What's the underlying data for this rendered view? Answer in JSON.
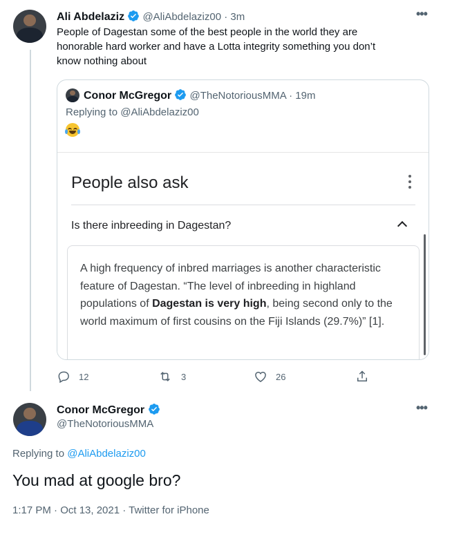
{
  "tweet1": {
    "author_name": "Ali Abdelaziz",
    "author_handle": "@AliAbdelaziz00",
    "time": "3m",
    "text_line1": "People of Dagestan some of the best people in the world they are",
    "text_line2": "honorable hard worker and  have a Lotta integrity something you don’t",
    "text_line3": "know nothing about"
  },
  "quote": {
    "author_name": "Conor McGregor",
    "author_handle": "@TheNotoriousMMA",
    "time": "19m",
    "replying_to": "Replying to @AliAbdelaziz00",
    "emoji": "face-with-tears-of-joy",
    "shot": {
      "title": "People also ask",
      "question": "Is there inbreeding in Dagestan?",
      "answer_part1": "A high frequency of inbred marriages is another characteristic feature of Dagestan. “The level of inbreeding in highland populations of ",
      "answer_bold": "Dagestan is very high",
      "answer_part2": ", being second only to the world maximum of first cousins on the Fiji Islands (29.7%)” [1]."
    }
  },
  "actions": {
    "replies": "12",
    "retweets": "3",
    "likes": "26"
  },
  "tweet2": {
    "author_name": "Conor McGregor",
    "author_handle": "@TheNotoriousMMA",
    "replying_label": "Replying to ",
    "replying_handle": "@AliAbdelaziz00",
    "text": "You mad at google bro?",
    "timestamp": "1:17 PM · Oct 13, 2021 · Twitter for iPhone"
  },
  "colors": {
    "verified": "#1d9bf0",
    "link": "#1d9bf0",
    "muted": "#536471"
  }
}
